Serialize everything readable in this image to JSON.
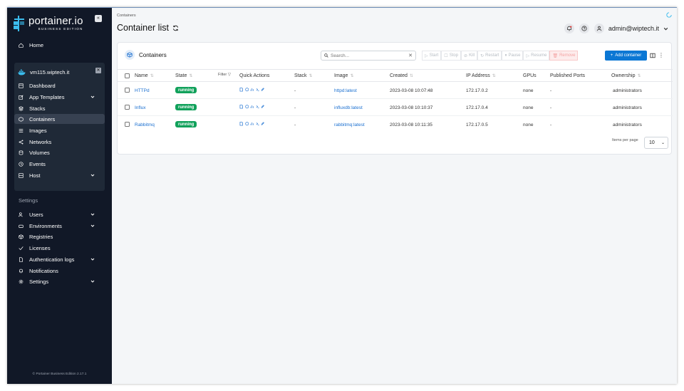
{
  "sidebar": {
    "logo_text": "portainer.io",
    "logo_sub": "BUSINESS EDITION",
    "home": "Home",
    "environment": "vm115.wiptech.it",
    "env_items": [
      {
        "label": "Dashboard",
        "icon": "dashboard-icon"
      },
      {
        "label": "App Templates",
        "icon": "edit-icon"
      },
      {
        "label": "Stacks",
        "icon": "stacks-icon"
      },
      {
        "label": "Containers",
        "icon": "box-icon"
      },
      {
        "label": "Images",
        "icon": "list-icon"
      },
      {
        "label": "Networks",
        "icon": "share-icon"
      },
      {
        "label": "Volumes",
        "icon": "database-icon"
      },
      {
        "label": "Events",
        "icon": "history-icon"
      },
      {
        "label": "Host",
        "icon": "server-icon"
      }
    ],
    "settings_heading": "Settings",
    "settings_items": [
      {
        "label": "Users"
      },
      {
        "label": "Environments"
      },
      {
        "label": "Registries"
      },
      {
        "label": "Licenses"
      },
      {
        "label": "Authentication logs"
      },
      {
        "label": "Notifications"
      },
      {
        "label": "Settings"
      }
    ],
    "footer": "© Portainer Business Edition 2.17.1"
  },
  "header": {
    "breadcrumb": "Containers",
    "title": "Container list",
    "user": "admin@wiptech.it"
  },
  "card": {
    "title": "Containers",
    "search_placeholder": "Search...",
    "actions": {
      "start": "Start",
      "stop": "Stop",
      "kill": "Kill",
      "restart": "Restart",
      "pause": "Pause",
      "resume": "Resume",
      "remove": "Remove"
    },
    "add_button": "Add container",
    "columns": {
      "name": "Name",
      "state": "State",
      "filter": "Filter",
      "quick_actions": "Quick Actions",
      "stack": "Stack",
      "image": "Image",
      "created": "Created",
      "ip": "IP Address",
      "gpus": "GPUs",
      "ports": "Published Ports",
      "ownership": "Ownership"
    },
    "rows": [
      {
        "name": "HTTPd",
        "state": "running",
        "stack": "-",
        "image": "httpd:latest",
        "created": "2023-03-08 10:07:48",
        "ip": "172.17.0.2",
        "gpus": "none",
        "ports": "-",
        "ownership": "administrators"
      },
      {
        "name": "Influx",
        "state": "running",
        "stack": "-",
        "image": "influxdb:latest",
        "created": "2023-03-08 10:10:37",
        "ip": "172.17.0.4",
        "gpus": "none",
        "ports": "-",
        "ownership": "administrators"
      },
      {
        "name": "Rabbitmq",
        "state": "running",
        "stack": "-",
        "image": "rabbitmq:latest",
        "created": "2023-03-08 10:11:35",
        "ip": "172.17.0.5",
        "gpus": "none",
        "ports": "-",
        "ownership": "administrators"
      }
    ],
    "items_per_page_label": "Items per page",
    "items_per_page": "10"
  },
  "colors": {
    "sidebar_bg": "#111827",
    "accent": "#0b77d4",
    "running": "#11a15b",
    "link": "#1a6fd0"
  }
}
